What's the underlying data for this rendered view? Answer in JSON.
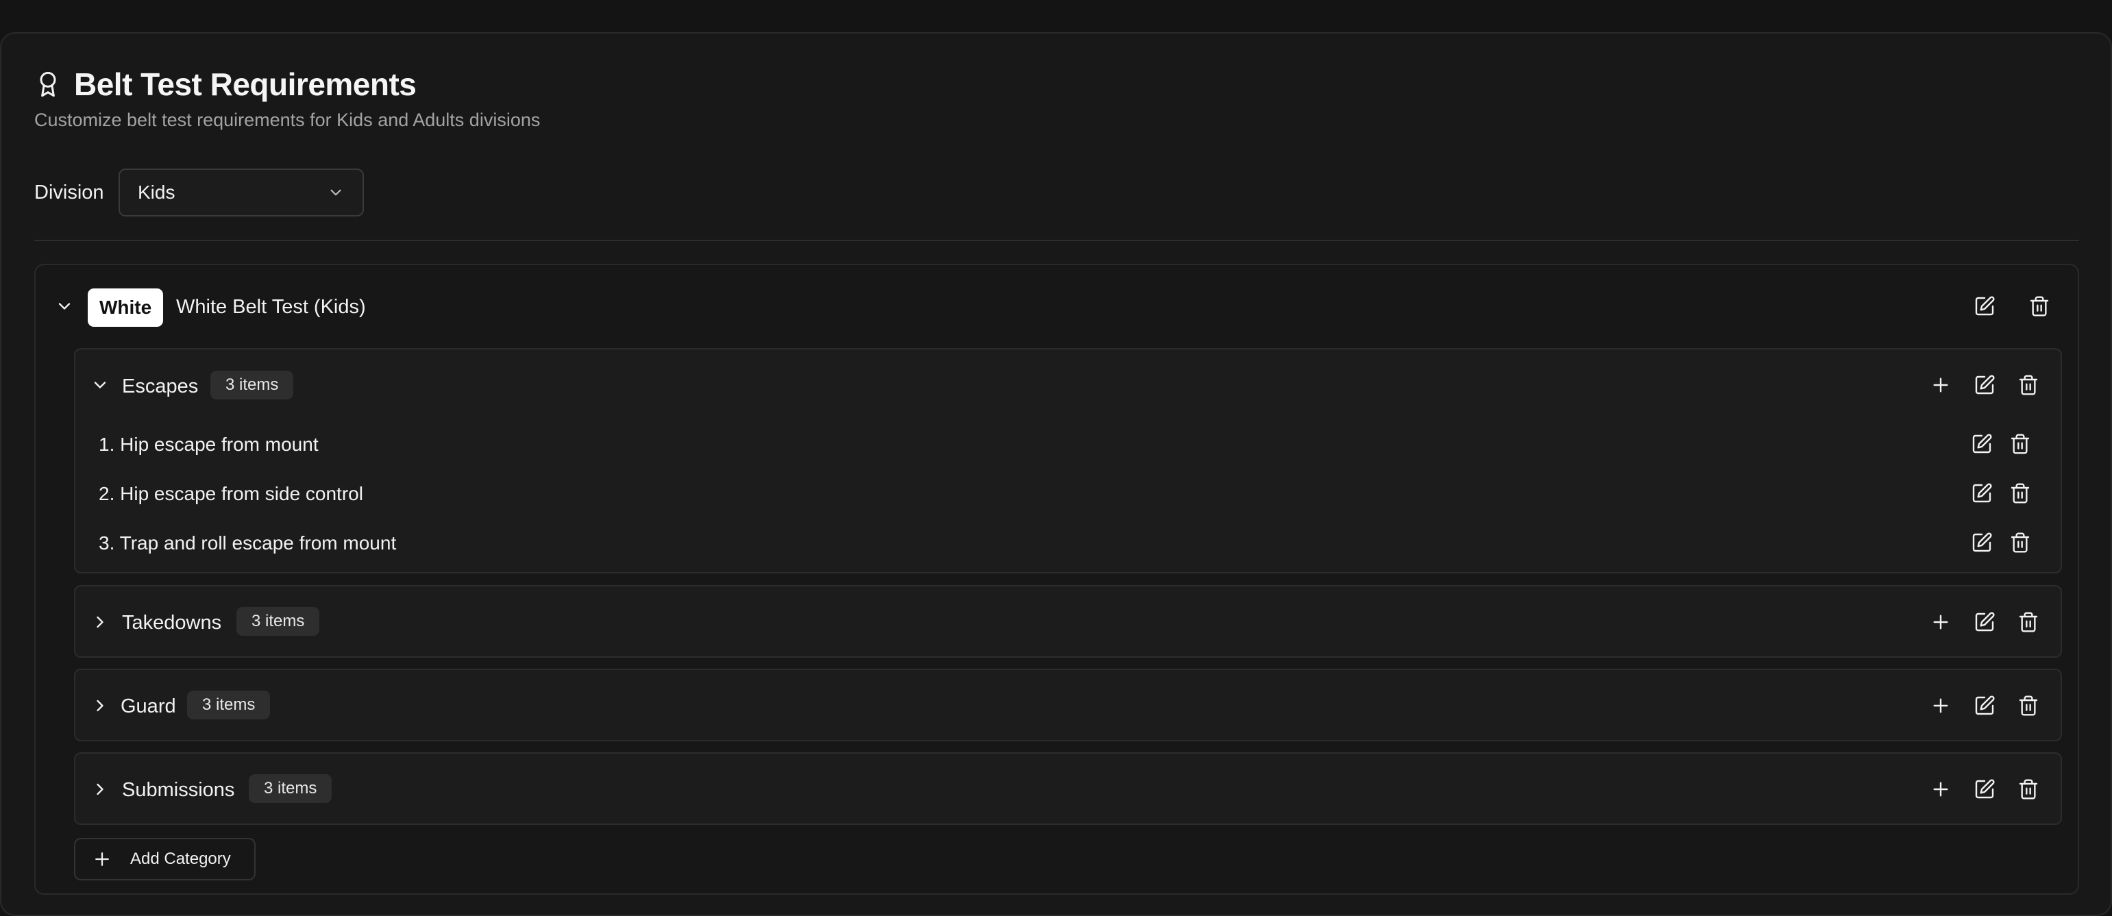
{
  "header": {
    "title": "Belt Test Requirements",
    "subtitle": "Customize belt test requirements for Kids and Adults divisions",
    "icon": "award-icon"
  },
  "division": {
    "label": "Division",
    "selected": "Kids"
  },
  "belt": {
    "badge": "White",
    "badge_color": "#ffffff",
    "name": "White Belt Test (Kids)",
    "expanded": true
  },
  "categories": [
    {
      "name": "Escapes",
      "count": "3 items",
      "expanded": true,
      "items": [
        "1. Hip escape from mount",
        "2. Hip escape from side control",
        "3. Trap and roll escape from mount"
      ]
    },
    {
      "name": "Takedowns",
      "count": "3 items",
      "expanded": false
    },
    {
      "name": "Guard",
      "count": "3 items",
      "expanded": false
    },
    {
      "name": "Submissions",
      "count": "3 items",
      "expanded": false
    }
  ],
  "actions": {
    "add_category": "Add Category"
  },
  "colors": {
    "background": "#141414",
    "card": "#181818",
    "badge_bg": "#2e2e2e"
  }
}
